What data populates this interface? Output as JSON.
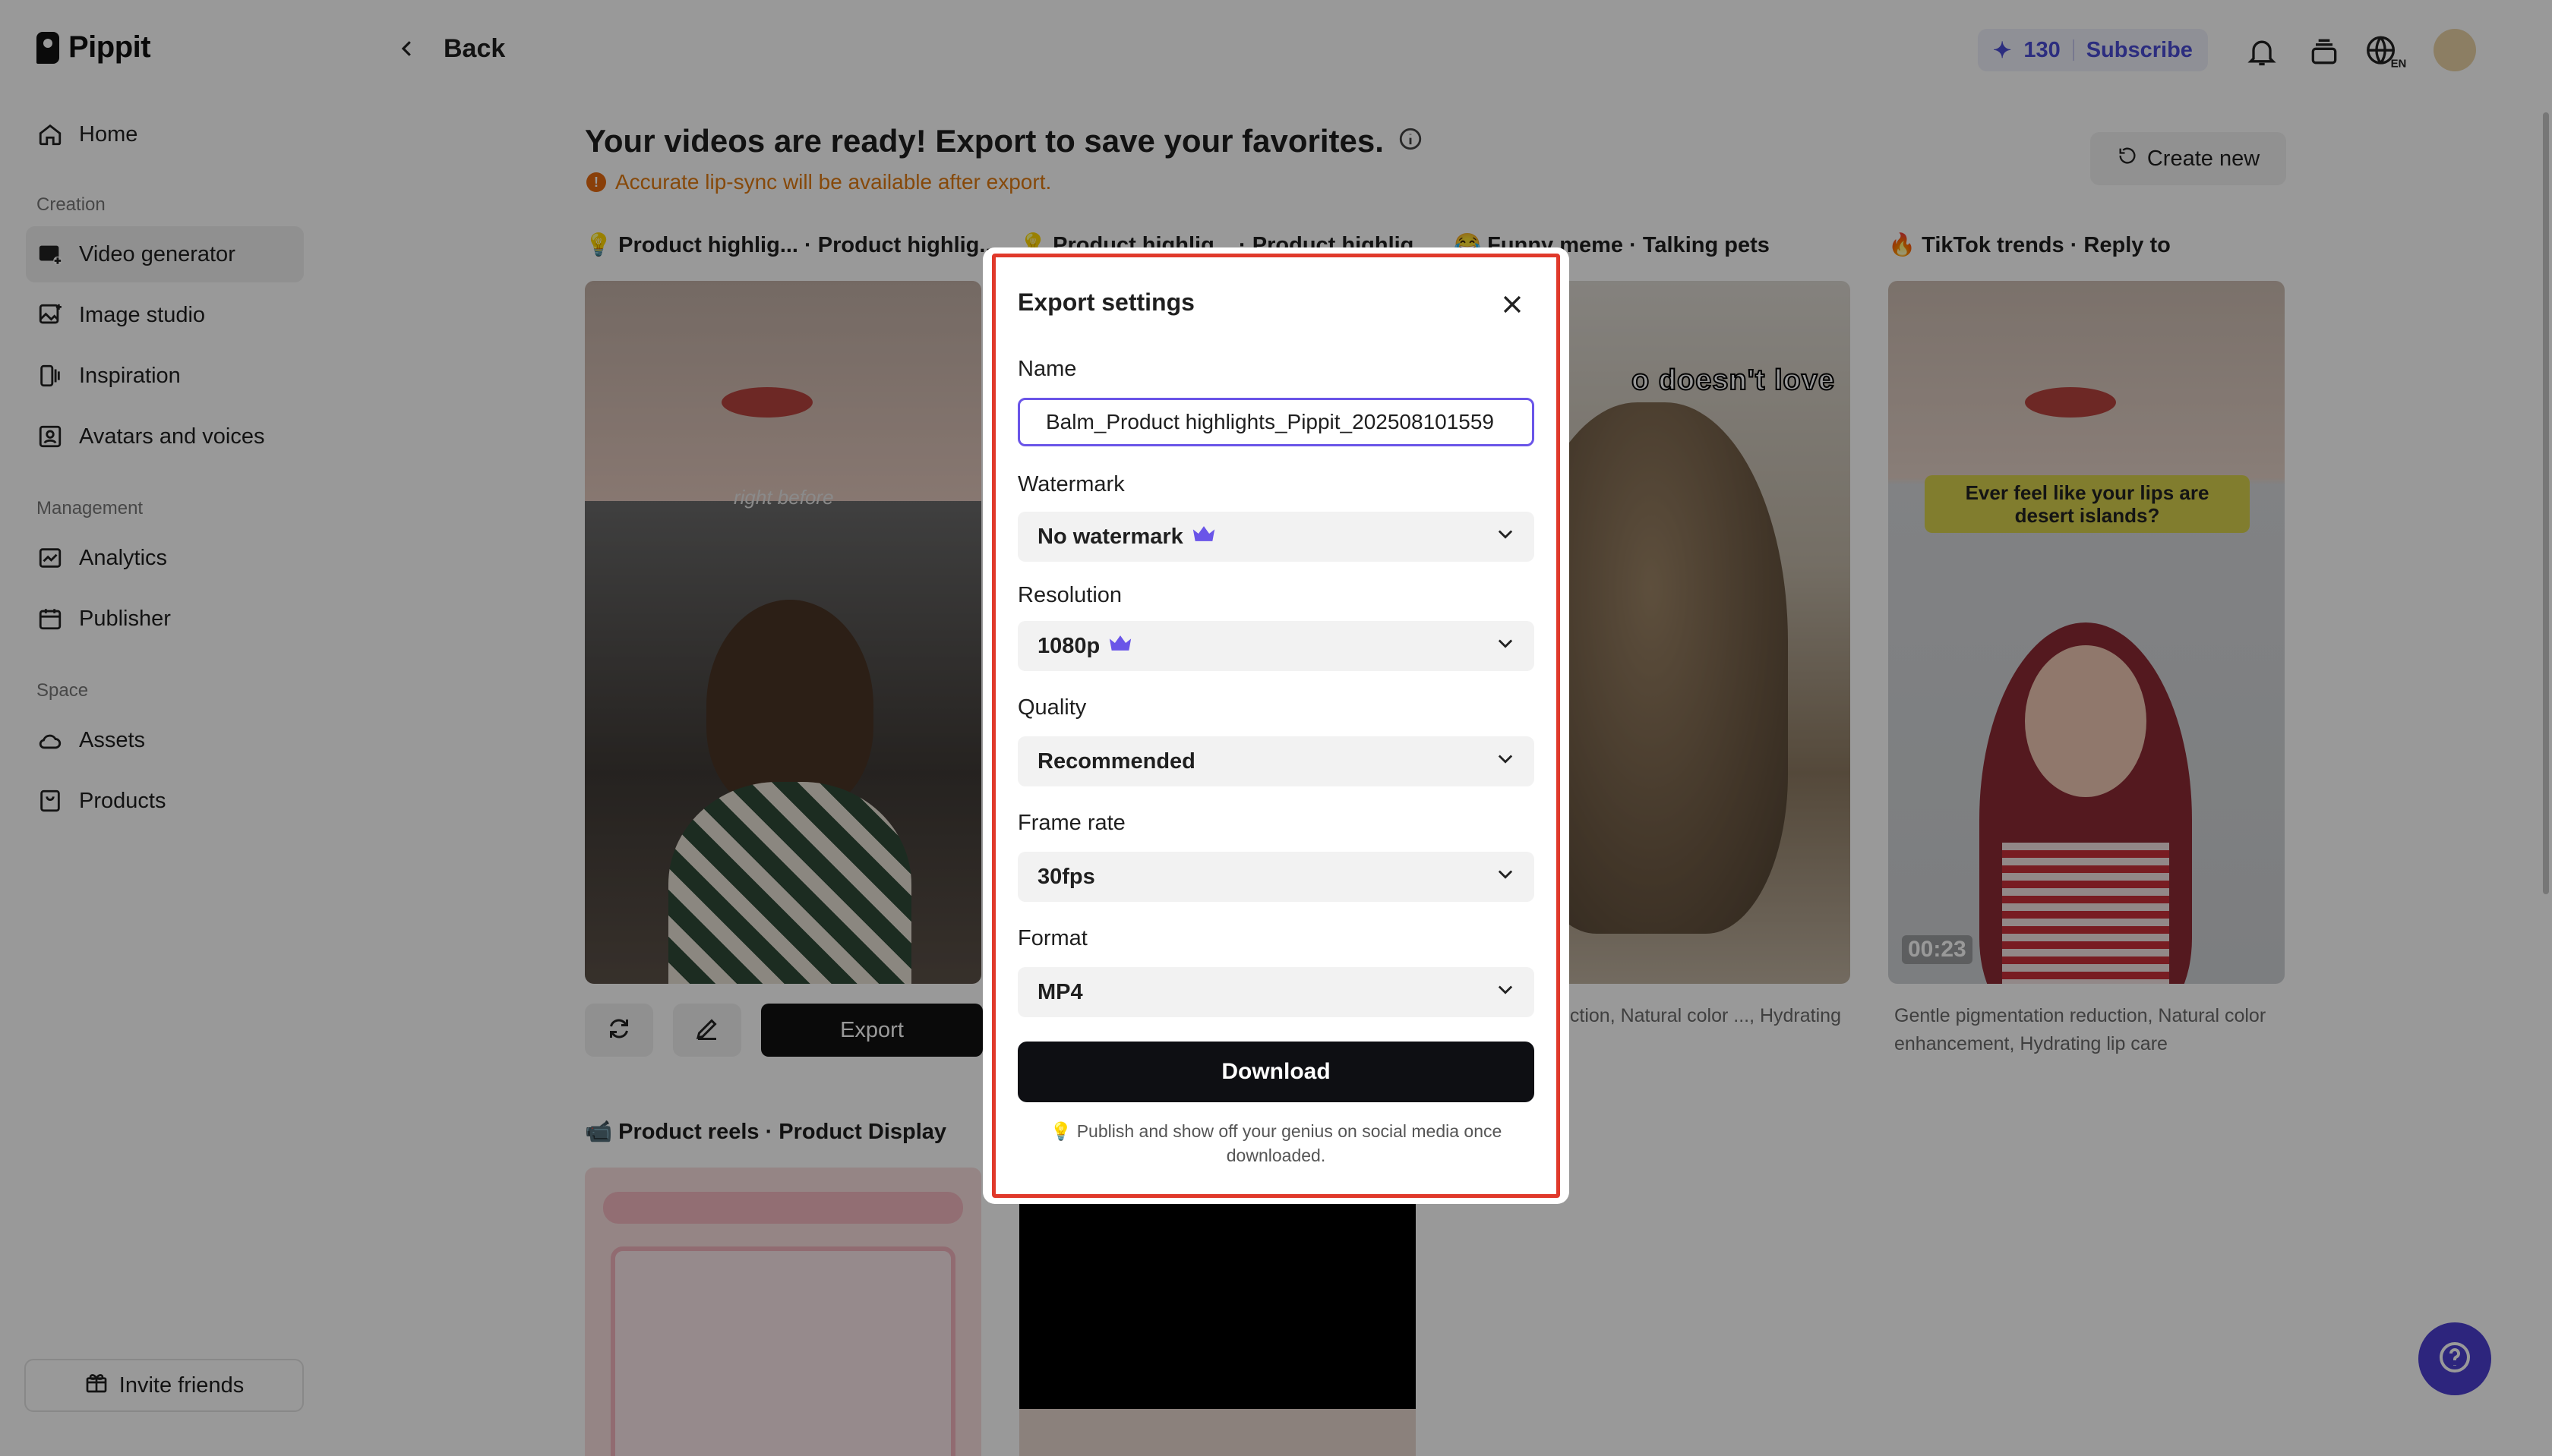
{
  "app": {
    "name": "Pippit"
  },
  "sidebar": {
    "home": "Home",
    "section_creation": "Creation",
    "video_generator": "Video generator",
    "image_studio": "Image studio",
    "inspiration": "Inspiration",
    "avatars_voices": "Avatars and voices",
    "section_management": "Management",
    "analytics": "Analytics",
    "publisher": "Publisher",
    "section_space": "Space",
    "assets": "Assets",
    "products": "Products",
    "invite": "Invite friends"
  },
  "topbar": {
    "back": "Back",
    "credits": "130",
    "subscribe": "Subscribe",
    "lang": "EN"
  },
  "main": {
    "title": "Your videos are ready! Export to save your favorites.",
    "note": "Accurate lip-sync will be available after export.",
    "create_new": "Create new",
    "cards": [
      {
        "title": "Product highlig... · Product highlig...",
        "emoji": "💡",
        "caption": "right before"
      },
      {
        "title": "Product highlig... · Product highlig...",
        "emoji": "💡"
      },
      {
        "title": "Funny meme · Talking pets",
        "emoji": "😂",
        "caption": "o doesn't love",
        "desc": "...ntation reduction, Natural color ..., Hydrating lip care"
      },
      {
        "title": "TikTok trends · Reply to",
        "emoji": "🔥",
        "caption": "Ever feel like your lips are desert islands?",
        "duration": "00:23",
        "desc": "Gentle pigmentation reduction, Natural color enhancement, Hydrating lip care"
      }
    ],
    "export_label": "Export",
    "section2_title": "Product reels · Product Display",
    "section2_emoji": "📹"
  },
  "modal": {
    "title": "Export settings",
    "name_label": "Name",
    "name_value": "Balm_Product highlights_Pippit_202508101559",
    "watermark_label": "Watermark",
    "watermark_value": "No watermark",
    "resolution_label": "Resolution",
    "resolution_value": "1080p",
    "quality_label": "Quality",
    "quality_value": "Recommended",
    "framerate_label": "Frame rate",
    "framerate_value": "30fps",
    "format_label": "Format",
    "format_value": "MP4",
    "download": "Download",
    "tip": "💡 Publish and show off your genius on social media once downloaded."
  },
  "colors": {
    "accent": "#4a4bd4",
    "highlight": "#e0392b",
    "primary_button": "#0e0f13"
  }
}
